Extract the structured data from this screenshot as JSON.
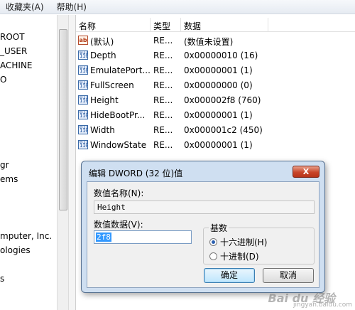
{
  "menu": [
    "收藏夹(A)",
    "帮助(H)"
  ],
  "tree": [
    "ROOT",
    "_USER",
    "ACHINE",
    "O",
    "gr",
    "ems",
    "mputer, Inc.",
    "ologies",
    "s"
  ],
  "list": {
    "headers": {
      "name": "名称",
      "type": "类型",
      "data": "数据"
    },
    "rows": [
      {
        "icon": "string-value-icon",
        "name": "(默认)",
        "type": "RE...",
        "data": "(数值未设置)"
      },
      {
        "icon": "dword-value-icon",
        "name": "Depth",
        "type": "RE...",
        "data": "0x00000010 (16)"
      },
      {
        "icon": "dword-value-icon",
        "name": "EmulatePort...",
        "type": "RE...",
        "data": "0x00000001 (1)"
      },
      {
        "icon": "dword-value-icon",
        "name": "FullScreen",
        "type": "RE...",
        "data": "0x00000000 (0)"
      },
      {
        "icon": "dword-value-icon",
        "name": "Height",
        "type": "RE...",
        "data": "0x000002f8 (760)"
      },
      {
        "icon": "dword-value-icon",
        "name": "HideBootPr...",
        "type": "RE...",
        "data": "0x00000001 (1)"
      },
      {
        "icon": "dword-value-icon",
        "name": "Width",
        "type": "RE...",
        "data": "0x000001c2 (450)"
      },
      {
        "icon": "dword-value-icon",
        "name": "WindowState",
        "type": "RE...",
        "data": "0x00000001 (1)"
      }
    ]
  },
  "dialog": {
    "title": "编辑 DWORD (32 位)值",
    "close": "X",
    "value_name_label": "数值名称(N):",
    "value_name": "Height",
    "value_data_label": "数值数据(V):",
    "value_data": "2f8",
    "base_label": "基数",
    "radio_hex": "十六进制(H)",
    "radio_dec": "十进制(D)",
    "selected_base": "hex",
    "ok": "确定",
    "cancel": "取消"
  },
  "watermark": {
    "logo": "Bai du 经验",
    "url": "jingyan.baidu.com"
  }
}
